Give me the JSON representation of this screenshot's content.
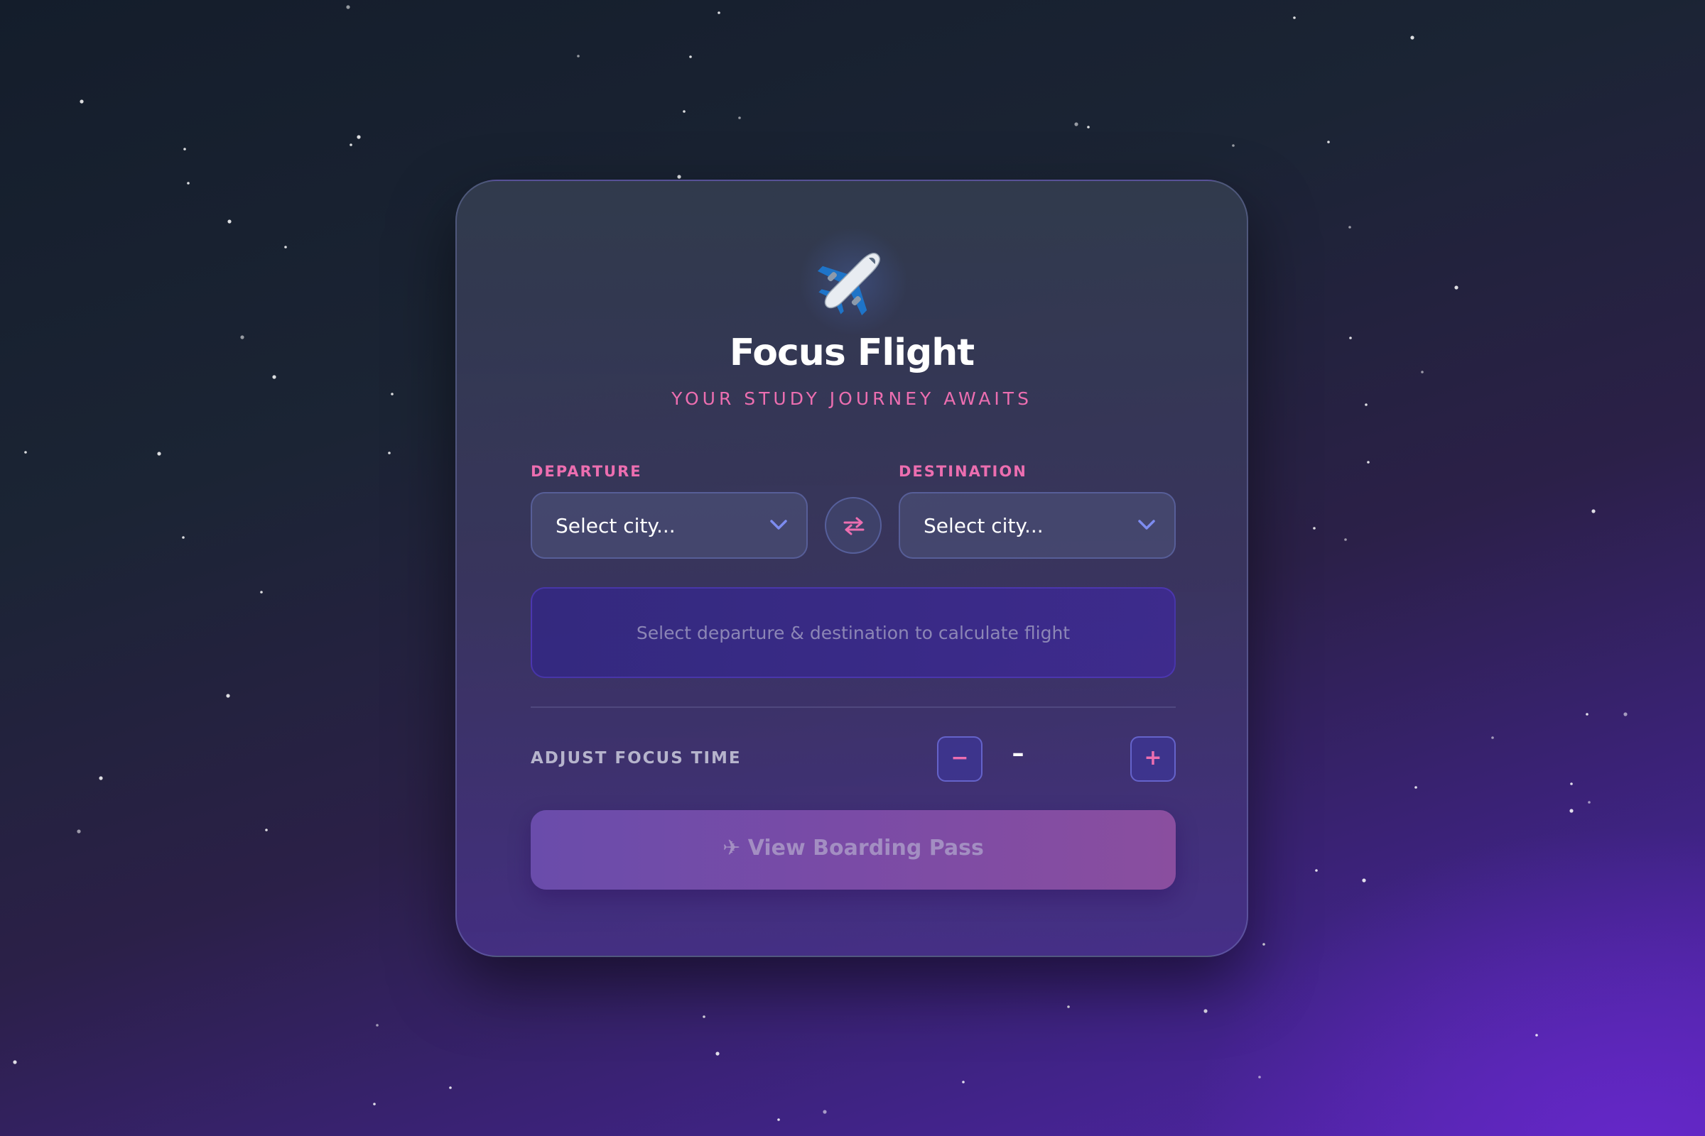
{
  "app": {
    "title": "Focus Flight",
    "subtitle": "YOUR STUDY JOURNEY AWAITS",
    "logo_icon": "airplane-icon"
  },
  "route": {
    "departure_label": "DEPARTURE",
    "departure_value": "Select city...",
    "destination_label": "DESTINATION",
    "destination_value": "Select city...",
    "swap_icon": "swap-arrows-icon"
  },
  "info": {
    "message": "Select departure & destination to calculate flight"
  },
  "focus": {
    "label": "ADJUST FOCUS TIME",
    "decrease_label": "−",
    "value": "–",
    "increase_label": "+"
  },
  "cta": {
    "label": "✈ View Boarding Pass"
  },
  "colors": {
    "accent_pink": "#ec6eb0",
    "accent_blue": "#7d8cf0",
    "card_bg": "#3c3862"
  }
}
